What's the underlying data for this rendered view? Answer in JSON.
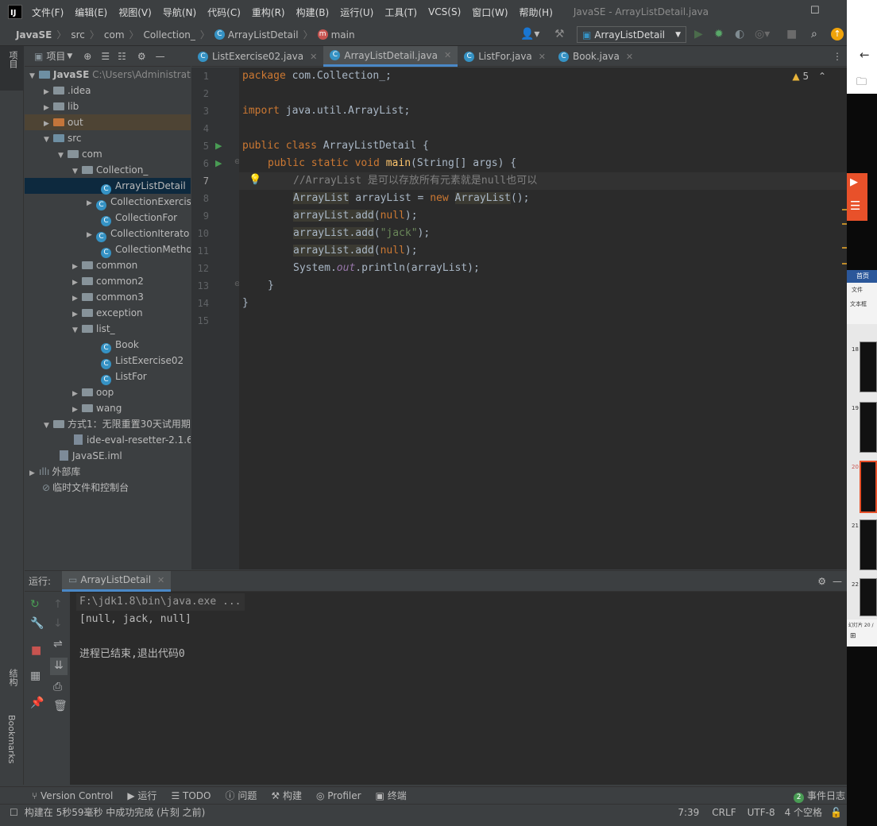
{
  "menu": {
    "items": [
      "文件(F)",
      "编辑(E)",
      "视图(V)",
      "导航(N)",
      "代码(C)",
      "重构(R)",
      "构建(B)",
      "运行(U)",
      "工具(T)",
      "VCS(S)",
      "窗口(W)",
      "帮助(H)"
    ],
    "window_title": "JavaSE - ArrayListDetail.java"
  },
  "breadcrumb": {
    "items": [
      "JavaSE",
      "src",
      "com",
      "Collection_",
      "ArrayListDetail",
      "main"
    ],
    "run_config": "ArrayListDetail"
  },
  "left_strip": {
    "project": "项目",
    "structure": "结构",
    "bookmarks": "Bookmarks"
  },
  "project_panel": {
    "title": "项目",
    "tree": [
      {
        "label": "JavaSE",
        "extra": "C:\\Users\\Administrat"
      },
      {
        "label": ".idea"
      },
      {
        "label": "lib"
      },
      {
        "label": "out"
      },
      {
        "label": "src"
      },
      {
        "label": "com"
      },
      {
        "label": "Collection_"
      },
      {
        "label": "ArrayListDetail"
      },
      {
        "label": "CollectionExercis"
      },
      {
        "label": "CollectionFor"
      },
      {
        "label": "CollectionIterato"
      },
      {
        "label": "CollectionMetho"
      },
      {
        "label": "common"
      },
      {
        "label": "common2"
      },
      {
        "label": "common3"
      },
      {
        "label": "exception"
      },
      {
        "label": "list_"
      },
      {
        "label": "Book"
      },
      {
        "label": "ListExercise02"
      },
      {
        "label": "ListFor"
      },
      {
        "label": "oop"
      },
      {
        "label": "wang"
      },
      {
        "label": "方式1：无限重置30天试用期"
      },
      {
        "label": "ide-eval-resetter-2.1.6."
      },
      {
        "label": "JavaSE.iml"
      },
      {
        "label": "外部库"
      },
      {
        "label": "临时文件和控制台"
      }
    ]
  },
  "tabs": [
    "ListExercise02.java",
    "ArrayListDetail.java",
    "ListFor.java",
    "Book.java"
  ],
  "editor": {
    "warning_count": "5",
    "line_numbers": [
      "1",
      "2",
      "3",
      "4",
      "5",
      "6",
      "7",
      "8",
      "9",
      "10",
      "11",
      "12",
      "13",
      "14",
      "15"
    ],
    "lines": {
      "l1_kw": "package",
      "l1_rest": " com.Collection_;",
      "l3_kw": "import",
      "l3_rest": " java.util.ArrayList;",
      "l5_kw": "public class",
      "l5_rest": " ArrayListDetail {",
      "l6_kw": "public static void",
      "l6_name": "main",
      "l6_rest": "(String[] args) {",
      "l7_comment": "//ArrayList 是可以存放所有元素就是null也可以",
      "l8_type": "ArrayList",
      "l8_mid": " arrayList = ",
      "l8_new": "new",
      "l8_type2": "ArrayList",
      "l8_end": "();",
      "l9_call": "arrayList.add",
      "l9_open": "(",
      "l9_arg": "null",
      "l9_end": ");",
      "l10_call": "arrayList.add",
      "l10_open": "(",
      "l10_arg": "\"jack\"",
      "l10_end": ");",
      "l11_call": "arrayList.add",
      "l11_open": "(",
      "l11_arg": "null",
      "l11_end": ");",
      "l12_pre": "System.",
      "l12_out": "out",
      "l12_rest": ".println(arrayList);",
      "l13": "}",
      "l14": "}"
    }
  },
  "run_panel": {
    "label": "运行:",
    "tab": "ArrayListDetail",
    "console": [
      "F:\\jdk1.8\\bin\\java.exe ...",
      "[null, jack, null]",
      "",
      "进程已结束,退出代码0"
    ]
  },
  "toolwindows": [
    "Version Control",
    "运行",
    "TODO",
    "问题",
    "构建",
    "Profiler",
    "终端"
  ],
  "event_log": {
    "count": "2",
    "label": "事件日志"
  },
  "status": {
    "message": "构建在 5秒59毫秒 中成功完成 (片刻 之前)",
    "position": "7:39",
    "line_sep": "CRLF",
    "encoding": "UTF-8",
    "indent": "4 个空格"
  },
  "right_panel": {
    "labels": [
      "首页",
      "文件",
      "文本框",
      "18",
      "19",
      "20",
      "21",
      "22",
      "幻灯片 20 /"
    ]
  },
  "colors": {
    "accent": "#4a88c7",
    "selection": "#0d293e",
    "editor_bg": "#2b2b2b",
    "panel_bg": "#3c3f41"
  }
}
